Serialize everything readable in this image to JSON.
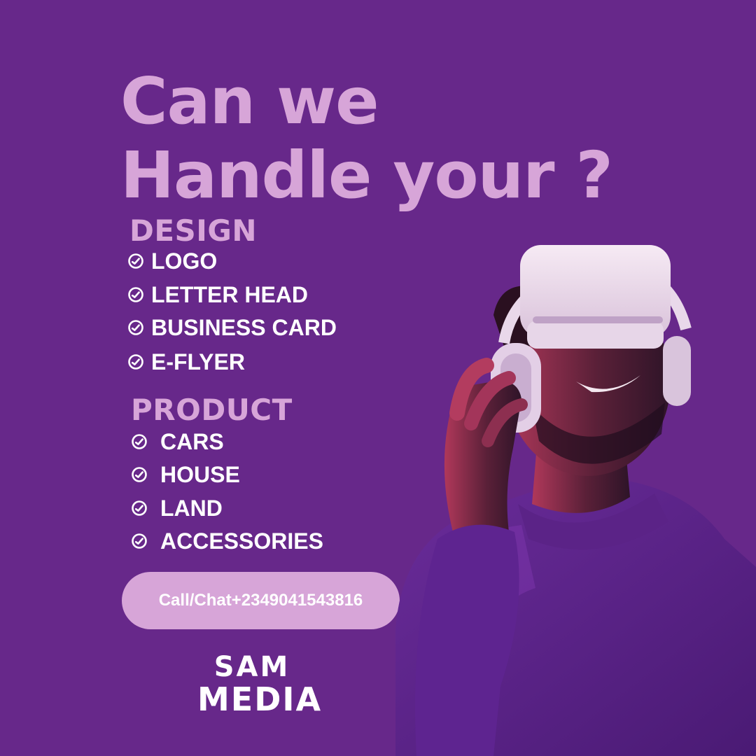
{
  "headline": {
    "line1": "Can we",
    "line2": "Handle your ?"
  },
  "sections": [
    {
      "title": "DESIGN",
      "items": [
        "LOGO",
        "LETTER HEAD",
        "BUSINESS CARD",
        "E-FLYER"
      ]
    },
    {
      "title": "PRODUCT",
      "items": [
        "CARS",
        "HOUSE",
        "LAND",
        "ACCESSORIES"
      ]
    }
  ],
  "cta": {
    "label": "Call/Chat+2349041543816"
  },
  "logo": {
    "line1": "SAM",
    "line2": "MEDIA"
  },
  "colors": {
    "background": "#67288a",
    "accent": "#d7a5d8",
    "text": "#ffffff"
  },
  "icons": {
    "bullet": "check-circle-icon"
  }
}
